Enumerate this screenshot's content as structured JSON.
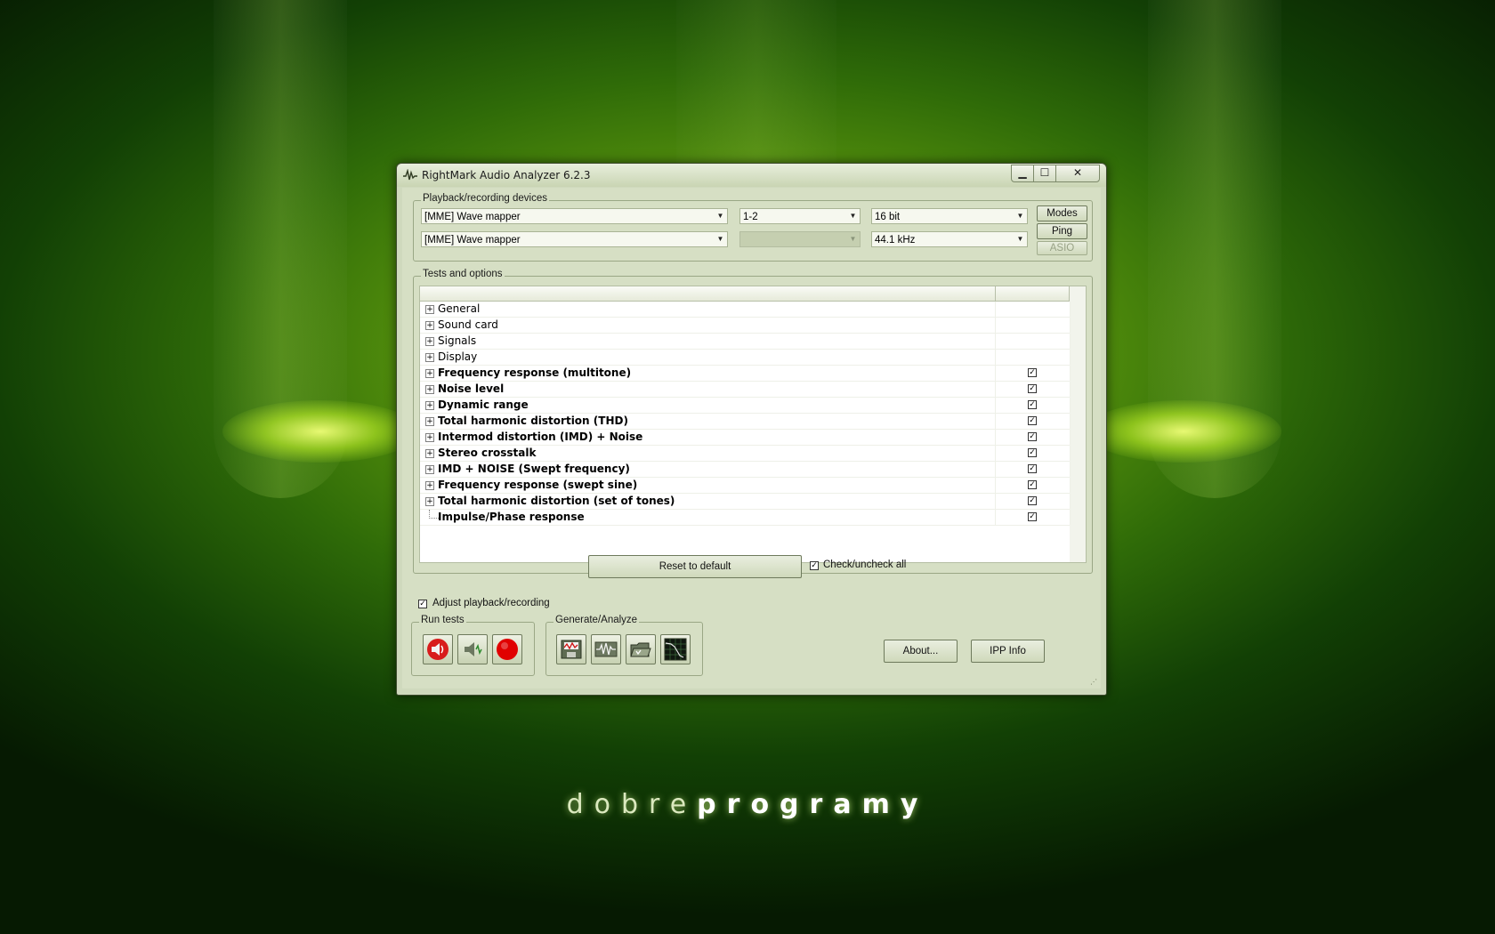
{
  "window": {
    "title": "RightMark Audio Analyzer 6.2.3",
    "minimize_glyph": "▁",
    "maximize_glyph": "☐",
    "close_glyph": "✕"
  },
  "devices": {
    "group_label": "Playback/recording devices",
    "playback_device": "[MME] Wave mapper",
    "recording_device": "[MME] Wave mapper",
    "channels": "1-2",
    "recording_channels": "",
    "bit_depth": "16 bit",
    "sample_rate": "44.1 kHz",
    "modes_label": "Modes",
    "ping_label": "Ping",
    "asio_label": "ASIO"
  },
  "tests": {
    "group_label": "Tests and options",
    "items": [
      {
        "label": "General",
        "bold": false,
        "expandable": true,
        "checked": null
      },
      {
        "label": "Sound card",
        "bold": false,
        "expandable": true,
        "checked": null
      },
      {
        "label": "Signals",
        "bold": false,
        "expandable": true,
        "checked": null
      },
      {
        "label": "Display",
        "bold": false,
        "expandable": true,
        "checked": null
      },
      {
        "label": "Frequency response (multitone)",
        "bold": true,
        "expandable": true,
        "checked": true
      },
      {
        "label": "Noise level",
        "bold": true,
        "expandable": true,
        "checked": true
      },
      {
        "label": "Dynamic range",
        "bold": true,
        "expandable": true,
        "checked": true
      },
      {
        "label": "Total harmonic distortion (THD)",
        "bold": true,
        "expandable": true,
        "checked": true
      },
      {
        "label": "Intermod distortion (IMD) + Noise",
        "bold": true,
        "expandable": true,
        "checked": true
      },
      {
        "label": "Stereo crosstalk",
        "bold": true,
        "expandable": true,
        "checked": true
      },
      {
        "label": "IMD + NOISE (Swept frequency)",
        "bold": true,
        "expandable": true,
        "checked": true
      },
      {
        "label": "Frequency response (swept sine)",
        "bold": true,
        "expandable": true,
        "checked": true
      },
      {
        "label": "Total harmonic distortion (set of tones)",
        "bold": true,
        "expandable": true,
        "checked": true
      },
      {
        "label": "Impulse/Phase response",
        "bold": true,
        "expandable": false,
        "checked": true
      }
    ],
    "reset_label": "Reset to default",
    "check_all_label": "Check/uncheck all",
    "check_all_checked": true
  },
  "options": {
    "adjust_label": "Adjust playback/recording",
    "adjust_checked": true
  },
  "run_tests": {
    "group_label": "Run tests",
    "buttons": [
      "speaker-record-icon",
      "speaker-icon",
      "record-icon"
    ]
  },
  "generate_analyze": {
    "group_label": "Generate/Analyze",
    "buttons": [
      "save-waveform-icon",
      "waveform-icon",
      "open-folder-icon",
      "graph-icon"
    ]
  },
  "footer": {
    "about_label": "About...",
    "ipp_label": "IPP Info"
  },
  "wallpaper": {
    "brand_light": "dobre",
    "brand_bold": "programy"
  },
  "colors": {
    "accent_green": "#8fbf1a",
    "window_bg": "#d6dfc4",
    "record_red": "#e00000"
  }
}
